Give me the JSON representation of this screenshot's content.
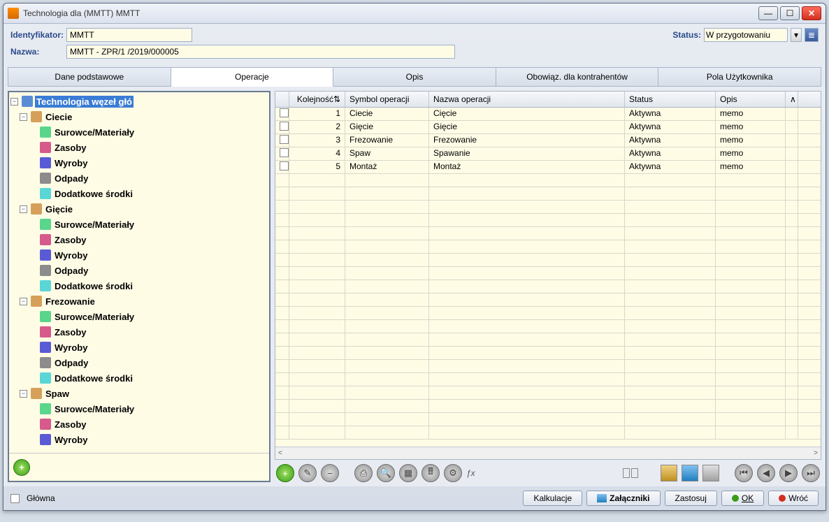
{
  "window": {
    "title": "Technologia dla (MMTT) MMTT"
  },
  "form": {
    "id_label": "Identyfikator:",
    "id_value": "MMTT",
    "name_label": "Nazwa:",
    "name_value": "MMTT - ZPR/1 /2019/000005",
    "status_label": "Status:",
    "status_value": "W przygotowaniu"
  },
  "tabs": [
    {
      "label": "Dane podstawowe",
      "active": false
    },
    {
      "label": "Operacje",
      "active": true
    },
    {
      "label": "Opis",
      "active": false
    },
    {
      "label": "Obowiąz. dla kontrahentów",
      "active": false
    },
    {
      "label": "Pola Użytkownika",
      "active": false
    }
  ],
  "tree": {
    "root_label": "Technologia węzeł głó",
    "children_labels": {
      "surowce": "Surowce/Materiały",
      "zasoby": "Zasoby",
      "wyroby": "Wyroby",
      "odpady": "Odpady",
      "dodatkowe": "Dodatkowe środki"
    },
    "operations": [
      "Ciecie",
      "Gięcie",
      "Frezowanie",
      "Spaw"
    ]
  },
  "grid": {
    "columns": {
      "kolejnosc": "Kolejność",
      "symbol": "Symbol operacji",
      "nazwa": "Nazwa operacji",
      "status": "Status",
      "opis": "Opis"
    },
    "rows": [
      {
        "ord": "1",
        "sym": "Ciecie",
        "nazwa": "Cięcie",
        "status": "Aktywna",
        "opis": "memo"
      },
      {
        "ord": "2",
        "sym": "Gięcie",
        "nazwa": "Gięcie",
        "status": "Aktywna",
        "opis": "memo"
      },
      {
        "ord": "3",
        "sym": "Frezowanie",
        "nazwa": "Frezowanie",
        "status": "Aktywna",
        "opis": "memo"
      },
      {
        "ord": "4",
        "sym": "Spaw",
        "nazwa": "Spawanie",
        "status": "Aktywna",
        "opis": "memo"
      },
      {
        "ord": "5",
        "sym": "Montaż",
        "nazwa": "Montaż",
        "status": "Aktywna",
        "opis": "memo"
      }
    ]
  },
  "toolbar_icons": {
    "fx_label": "ƒx"
  },
  "footer": {
    "glowna_label": "Główna",
    "kalkulacje": "Kalkulacje",
    "zalaczniki": "Załączniki",
    "zastosuj": "Zastosuj",
    "ok": "OK",
    "wroc": "Wróć"
  }
}
